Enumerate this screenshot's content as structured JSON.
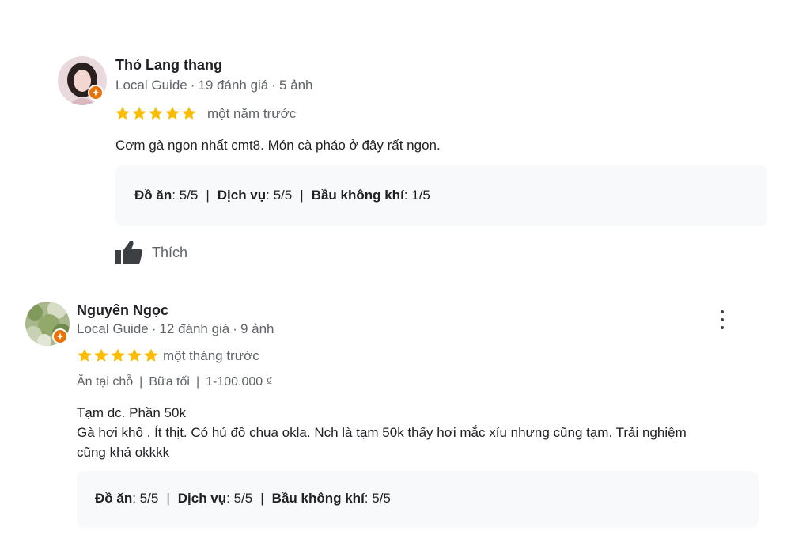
{
  "reviews": [
    {
      "author": "Thỏ Lang thang",
      "role": "Local Guide",
      "review_count": "19 đánh giá",
      "photo_count": "5 ảnh",
      "rating": 5,
      "time": "một năm trước",
      "text": "Cơm gà ngon nhất cmt8. Món cà pháo ở đây rất ngon.",
      "scores": [
        {
          "label": "Đồ ăn",
          "value": ": 5/5"
        },
        {
          "label": "Dịch vụ",
          "value": ": 5/5"
        },
        {
          "label": "Bầu không khí",
          "value": ": 1/5"
        }
      ],
      "like_label": "Thích"
    },
    {
      "author": "Nguyên Ngọc",
      "role": "Local Guide",
      "review_count": "12 đánh giá",
      "photo_count": "9 ảnh",
      "rating": 5,
      "time": "một tháng trước",
      "tags": [
        "Ăn tại chỗ",
        "Bữa tối",
        "1-100.000 ₫"
      ],
      "text_lines": [
        "Tạm dc. Phần 50k",
        "Gà hơi khô . Ít thịt. Có hủ đồ chua okla. Nch là tạm 50k thấy hơi mắc xíu nhưng cũng tạm. Trải nghiệm",
        "cũng khá okkkk"
      ],
      "scores": [
        {
          "label": "Đồ ăn",
          "value": ": 5/5"
        },
        {
          "label": "Dịch vụ",
          "value": ": 5/5"
        },
        {
          "label": "Bầu không khí",
          "value": ": 5/5"
        }
      ]
    }
  ],
  "colors": {
    "star": "#fbbc04",
    "badge": "#e8710a",
    "panel": "#f8f9fa"
  },
  "icons": {
    "star": "star-icon",
    "like": "thumbs-up-icon",
    "more": "more-vert-icon",
    "badge": "local-guide-badge-icon"
  }
}
